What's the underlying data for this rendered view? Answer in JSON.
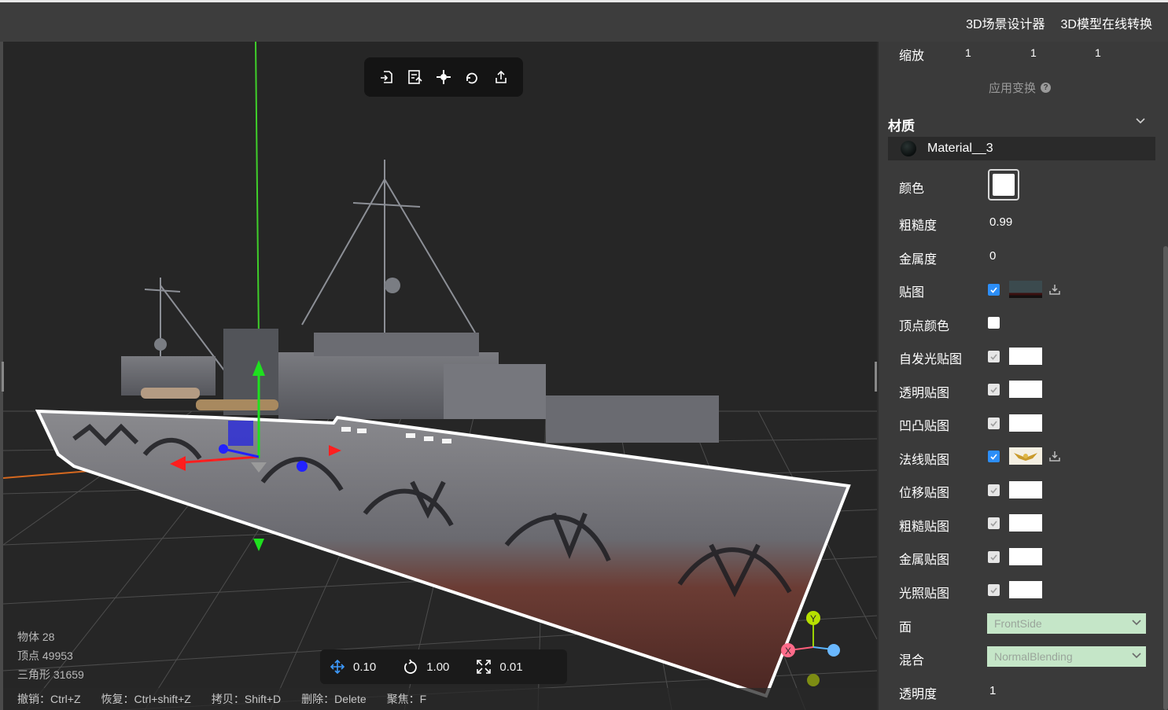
{
  "header": {
    "links": [
      "3D场景设计器",
      "3D模型在线转换"
    ]
  },
  "toolbar": {
    "icons": [
      "import-icon",
      "export-scene-icon",
      "center-icon",
      "reset-icon",
      "share-icon"
    ]
  },
  "stats": {
    "objects": "物体 28",
    "vertices": "顶点 49953",
    "triangles": "三角形 31659"
  },
  "shortcuts": [
    "撤销：Ctrl+Z",
    "恢复：Ctrl+shift+Z",
    "拷贝：Shift+D",
    "删除：Delete",
    "聚焦：F"
  ],
  "transform_bar": {
    "translate": "0.10",
    "rotate": "1.00",
    "scale": "0.01"
  },
  "axis_gizmo": {
    "x": "X",
    "y": "Y"
  },
  "panel": {
    "scale_label": "缩放",
    "scale_values": [
      "1",
      "1",
      "1"
    ],
    "apply_transform": "应用变换",
    "help_glyph": "?",
    "material_section": "材质",
    "material_name": "Material__3",
    "color_label": "颜色",
    "roughness_label": "粗糙度",
    "roughness_value": "0.99",
    "metalness_label": "金属度",
    "metalness_value": "0",
    "maps": [
      {
        "label": "贴图",
        "checked": true
      },
      {
        "label": "顶点颜色",
        "checked": false
      },
      {
        "label": "自发光贴图",
        "checked": false
      },
      {
        "label": "透明贴图",
        "checked": false
      },
      {
        "label": "凹凸贴图",
        "checked": false
      },
      {
        "label": "法线贴图",
        "checked": true
      },
      {
        "label": "位移贴图",
        "checked": false
      },
      {
        "label": "粗糙贴图",
        "checked": false
      },
      {
        "label": "金属贴图",
        "checked": false
      },
      {
        "label": "光照贴图",
        "checked": false
      }
    ],
    "side_label": "面",
    "side_value": "FrontSide",
    "blend_label": "混合",
    "blend_value": "NormalBlending",
    "opacity_label": "透明度",
    "opacity_value": "1",
    "colors": {
      "accent": "#2c8ef8",
      "select_bg": "#c5e6c8"
    }
  }
}
